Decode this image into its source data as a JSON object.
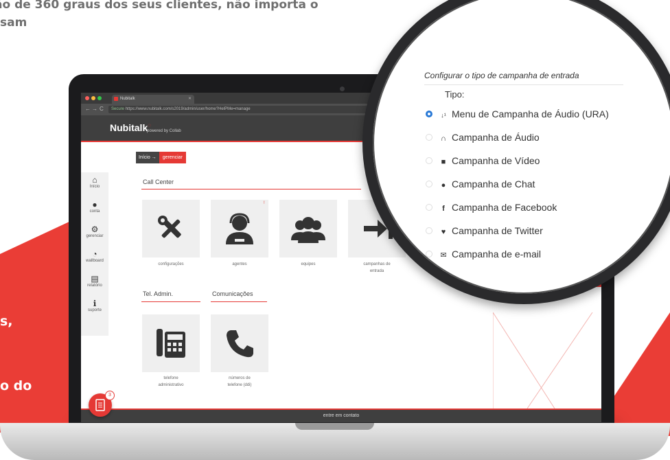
{
  "hero": {
    "line1": "ão de 360 graus dos seus clientes, não importa o",
    "line2": "sam"
  },
  "left_panel": {
    "text1": "s,",
    "text2": "o do"
  },
  "browser": {
    "tab_title": "Nubitalk",
    "secure_label": "Secure",
    "url": "https://www.nubitalk.com/s2019/admin/user/home?HelPMe=manage"
  },
  "app": {
    "logo": "Nubitalk",
    "powered_by": "powered by Collab",
    "breadcrumb": [
      "Início →",
      "gerenciar"
    ],
    "sidebar": [
      {
        "icon": "home-icon",
        "glyph": "⌂",
        "label": "Início"
      },
      {
        "icon": "user-icon",
        "glyph": "●",
        "label": "conta"
      },
      {
        "icon": "gears-icon",
        "glyph": "⚙",
        "label": "gerenciar"
      },
      {
        "icon": "gauge-icon",
        "glyph": "◔",
        "label": "wallboard"
      },
      {
        "icon": "report-icon",
        "glyph": "▤",
        "label": "relatório"
      },
      {
        "icon": "info-icon",
        "glyph": "ℹ",
        "label": "suporte"
      }
    ],
    "sections": {
      "call_center": "Call Center",
      "tel_admin": "Tel. Admin.",
      "comunicacoes": "Comunicações"
    },
    "tiles": {
      "configuracoes": "configurações",
      "agentes": "agentes",
      "agentes_badge": "!",
      "equipes": "equipes",
      "campanhas_line1": "campanhas de",
      "campanhas_line2": "entrada",
      "telefone_line1": "telefone",
      "telefone_line2": "administrativo",
      "numeros_line1": "números de",
      "numeros_line2": "telefone (ddi)"
    },
    "footer": "entre em contato",
    "fab_count": "3"
  },
  "magnifier": {
    "title": "Configurar o tipo de campanha de entrada",
    "tipo_label": "Tipo:",
    "options": [
      {
        "icon": "sort-numeric-icon",
        "glyph": "↓¹₉",
        "label": "Menu de Campanha de Áudio (URA)",
        "selected": true
      },
      {
        "icon": "headset-icon",
        "glyph": "∩",
        "label": "Campanha de Áudio",
        "selected": false
      },
      {
        "icon": "video-icon",
        "glyph": "■",
        "label": "Campanha de Vídeo",
        "selected": false
      },
      {
        "icon": "chat-icon",
        "glyph": "●",
        "label": "Campanha de Chat",
        "selected": false
      },
      {
        "icon": "facebook-icon",
        "glyph": "f",
        "label": "Campanha de Facebook",
        "selected": false
      },
      {
        "icon": "twitter-icon",
        "glyph": "♥",
        "label": "Campanha de Twitter",
        "selected": false
      },
      {
        "icon": "envelope-icon",
        "glyph": "✉",
        "label": "Campanha de e-mail",
        "selected": false
      }
    ]
  },
  "colors": {
    "accent_red": "#ea3d36",
    "radio_blue": "#2979d6",
    "header_dark": "#3f3f3f"
  }
}
